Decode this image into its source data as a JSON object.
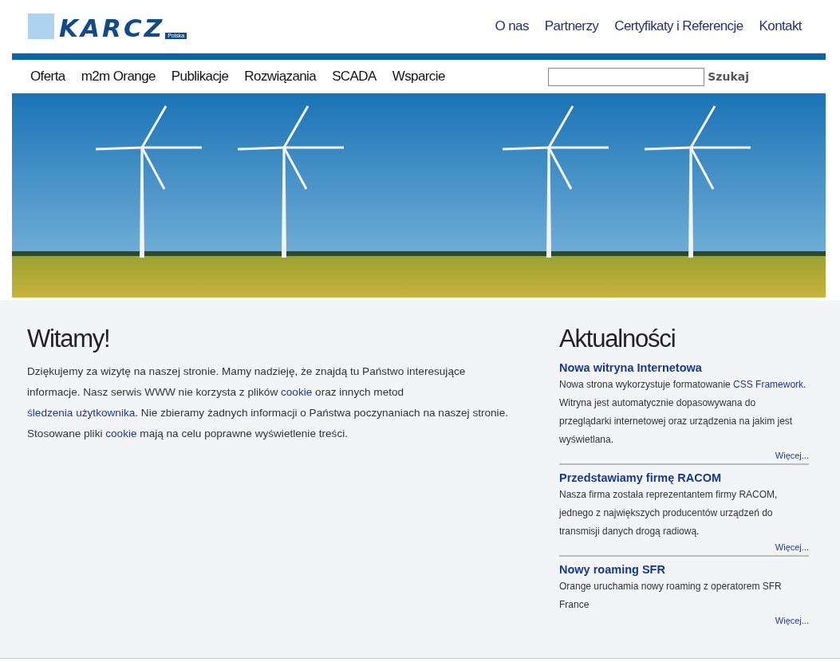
{
  "logo": {
    "name": "KARCZ",
    "subtitle": "Polska"
  },
  "top_menu": [
    {
      "label": "O nas"
    },
    {
      "label": "Partnerzy"
    },
    {
      "label": "Certyfikaty i Referencje"
    },
    {
      "label": "Kontakt"
    }
  ],
  "main_menu": [
    {
      "label": "Oferta"
    },
    {
      "label": "m2m Orange"
    },
    {
      "label": "Publikacje"
    },
    {
      "label": "Rozwiązania"
    },
    {
      "label": "SCADA"
    },
    {
      "label": "Wsparcie"
    }
  ],
  "search": {
    "button": "Szukaj"
  },
  "welcome": {
    "title": "Witamy!",
    "paragraph": [
      {
        "kind": "text",
        "text": "Dziękujemy za wizytę na naszej stronie. Mamy nadzieję, że znajdą tu Państwo interesujące informacje. Nasz serwis WWW nie korzysta z plików "
      },
      {
        "kind": "link",
        "text": "cookie"
      },
      {
        "kind": "text",
        "text": " oraz innych metod "
      },
      {
        "kind": "link",
        "text": "śledzenia użytkownika"
      },
      {
        "kind": "text",
        "text": ". Nie zbieramy żadnych informacji o Państwa poczynaniach na naszej stronie. Stosowane pliki "
      },
      {
        "kind": "link",
        "text": "cookie"
      },
      {
        "kind": "text",
        "text": " mają na celu poprawne wyświetlenie treści."
      }
    ]
  },
  "news": {
    "title": "Aktualności",
    "items": [
      {
        "title": "Nowa witryna Internetowa",
        "body": [
          {
            "kind": "text",
            "text": "Nowa strona wykorzystuje formatowanie "
          },
          {
            "kind": "link",
            "text": "CSS Framework"
          },
          {
            "kind": "text",
            "text": ". Witryna jest automatycznie dopasowywana do przeglądarki internetowej oraz urządzenia na jakim jest wyświetlana."
          }
        ],
        "more": "Więcej..."
      },
      {
        "title": "Przedstawiamy firmę RACOM",
        "body": [
          {
            "kind": "text",
            "text": "Nasza firma została reprezentantem firmy RACOM, jednego z największych producentów urządzeń do transmisji danych drogą radiową."
          }
        ],
        "more": "Więcej..."
      },
      {
        "title": "Nowy roaming SFR",
        "body": [
          {
            "kind": "text",
            "text": "Orange uruchamia nowy roaming z operatorem SFR France"
          }
        ],
        "more": "Więcej..."
      }
    ]
  }
}
